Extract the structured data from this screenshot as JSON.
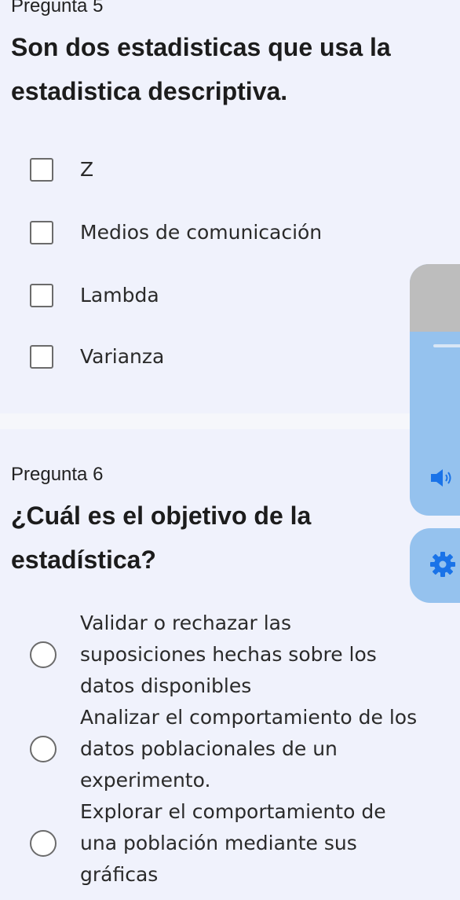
{
  "question5": {
    "label": "Pregunta 5",
    "title": "Son dos estadisticas que usa la estadistica descriptiva.",
    "options": [
      {
        "text": "Z"
      },
      {
        "text": "Medios de comunicación"
      },
      {
        "text": "Lambda"
      },
      {
        "text": "Varianza"
      }
    ]
  },
  "question6": {
    "label": "Pregunta 6",
    "title": "¿Cuál es el objetivo de la estadística?",
    "options": [
      {
        "text": "Validar o rechazar las suposiciones hechas sobre los datos disponibles"
      },
      {
        "text": "Analizar el comportamiento de los datos poblacionales de un experimento."
      },
      {
        "text": "Explorar el comportamiento de una población mediante sus gráficas"
      }
    ]
  },
  "side_widget": {
    "icons": [
      "speaker-icon",
      "gear-icon"
    ],
    "accent": "#95c2ee"
  }
}
